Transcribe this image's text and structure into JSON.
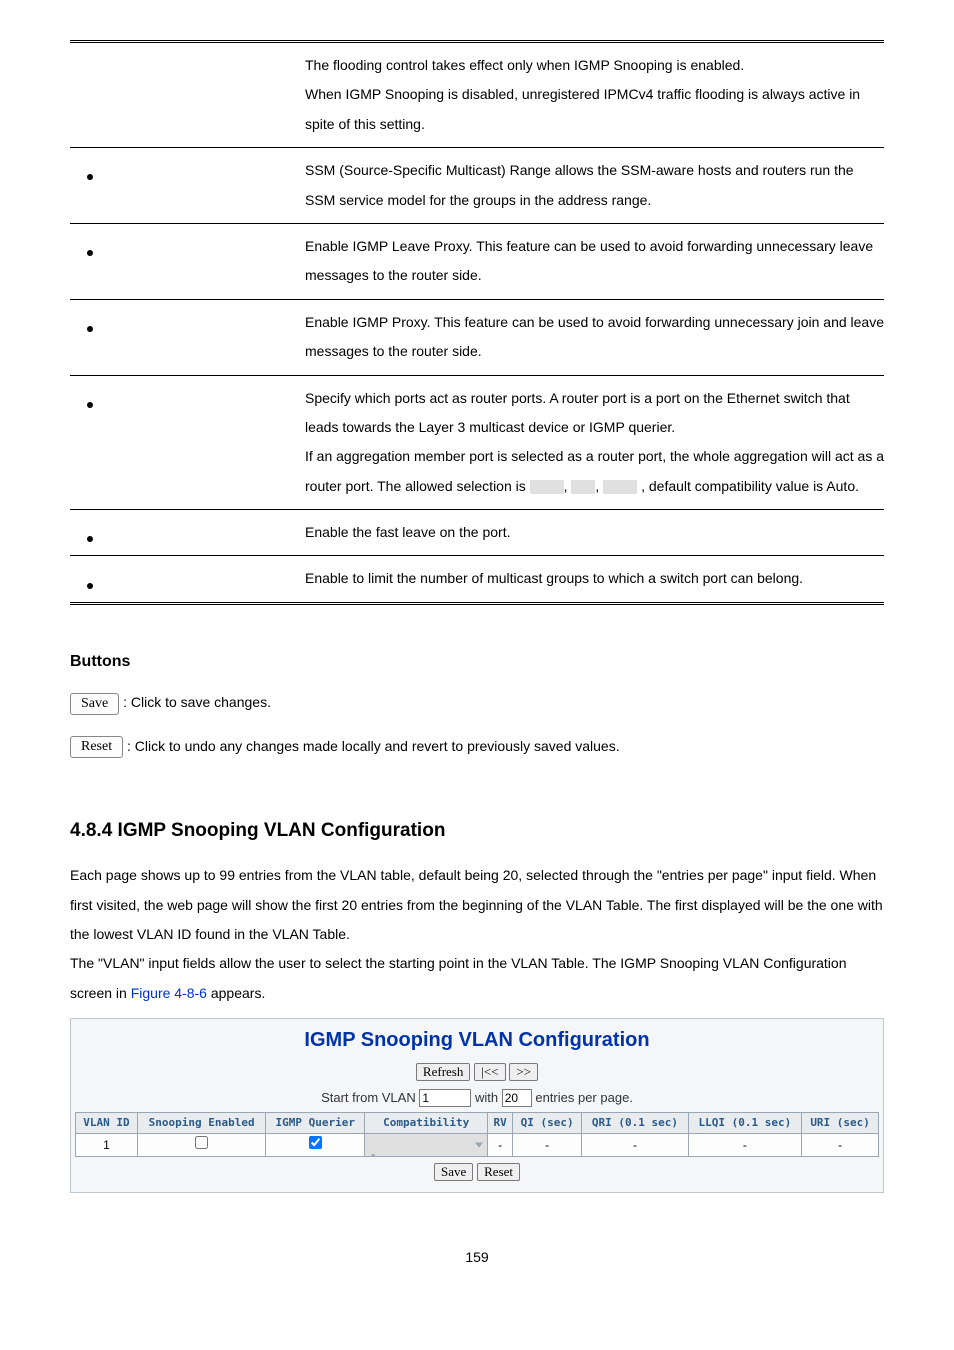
{
  "params": {
    "unreg_flood": {
      "line1": "The flooding control takes effect only when IGMP Snooping is enabled.",
      "line2": "When IGMP Snooping is disabled, unregistered IPMCv4 traffic flooding is always active in spite of this setting."
    },
    "ssm": "SSM (Source-Specific Multicast) Range allows the SSM-aware hosts and routers run the SSM service model for the groups in the address range.",
    "leave_proxy": "Enable IGMP Leave Proxy. This feature can be used to avoid forwarding unnecessary leave messages to the router side.",
    "proxy": "Enable IGMP Proxy. This feature can be used to avoid forwarding unnecessary join and leave messages to the router side.",
    "router_port": {
      "p1": "Specify which ports act as router ports. A router port is a port on the Ethernet switch that leads towards the Layer 3 multicast device or IGMP querier.",
      "p2a": "If an aggregation member port is selected as a router port, the whole aggregation will act as a router port. The allowed selection is ",
      "p2b": ", default compatibility value is Auto."
    },
    "fast_leave": "Enable the fast leave on the port.",
    "throttling": "Enable to limit the number of multicast groups to which a switch port can belong."
  },
  "buttons_heading": "Buttons",
  "save_btn": "Save",
  "save_desc": ": Click to save changes.",
  "reset_btn": "Reset",
  "reset_desc": ": Click to undo any changes made locally and revert to previously saved values.",
  "section": {
    "num": "4.8.4 IGMP Snooping VLAN Configuration",
    "p1": "Each page shows up to 99 entries from the VLAN table, default being 20, selected through the \"entries per page\" input field. When first visited, the web page will show the first 20 entries from the beginning of the VLAN Table. The first displayed will be the one with the lowest VLAN ID found in the VLAN Table.",
    "p2a": "The \"VLAN\" input fields allow the user to select the starting point in the VLAN Table. The IGMP Snooping VLAN Configuration screen in ",
    "figlink": "Figure 4-8-6",
    "p2b": " appears."
  },
  "chart_data": {
    "type": "table",
    "title": "IGMP Snooping VLAN Configuration",
    "toolbar": {
      "refresh": "Refresh",
      "first": "|<<",
      "next": ">>"
    },
    "start_label_pre": "Start from VLAN",
    "start_vlan": "1",
    "with_label": "with",
    "entries": "20",
    "entries_suffix": "entries per page.",
    "headers": [
      "VLAN ID",
      "Snooping Enabled",
      "IGMP Querier",
      "Compatibility",
      "RV",
      "QI (sec)",
      "QRI (0.1 sec)",
      "LLQI (0.1 sec)",
      "URI (sec)"
    ],
    "rows": [
      {
        "vlan_id": "1",
        "snooping_enabled": false,
        "igmp_querier": true,
        "compat": "-",
        "rv": "-",
        "qi": "-",
        "qri": "-",
        "llqi": "-",
        "uri": "-"
      }
    ],
    "bottom": {
      "save": "Save",
      "reset": "Reset"
    }
  },
  "page_number": "159"
}
